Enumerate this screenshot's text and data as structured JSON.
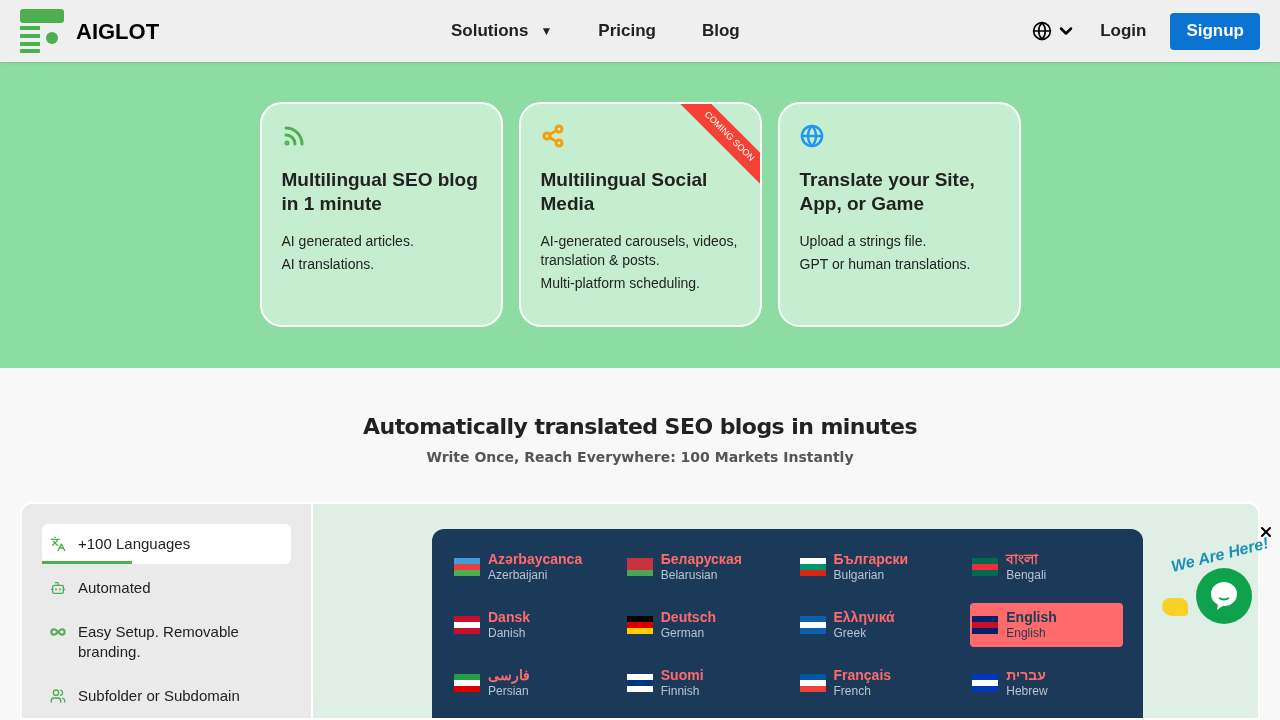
{
  "header": {
    "logo": "AIGLOT",
    "nav": [
      {
        "label": "Solutions",
        "caret": "▼"
      },
      {
        "label": "Pricing"
      },
      {
        "label": "Blog"
      }
    ],
    "login": "Login",
    "signup": "Signup"
  },
  "cards": [
    {
      "title": "Multilingual SEO blog in 1 minute",
      "lines": [
        "AI generated articles.",
        "AI translations."
      ]
    },
    {
      "title": "Multilingual Social Media",
      "lines": [
        "AI-generated carousels, videos, translation & posts.",
        "Multi-platform scheduling."
      ],
      "ribbon": "COMING SOON"
    },
    {
      "title": "Translate your Site, App, or Game",
      "lines": [
        "Upload a strings file.",
        "GPT or human translations."
      ]
    }
  ],
  "section": {
    "title": "Automatically translated SEO blogs in minutes",
    "subtitle": "Write Once, Reach Everywhere: 100 Markets Instantly"
  },
  "features": [
    {
      "label": "+100 Languages",
      "selected": true
    },
    {
      "label": "Automated",
      "selected": false
    },
    {
      "label": "Easy Setup. Removable branding.",
      "selected": false
    },
    {
      "label": "Subfolder or Subdomain",
      "selected": false
    }
  ],
  "languages": [
    {
      "native": "Azərbaycanca",
      "english": "Azerbaijani",
      "selected": false
    },
    {
      "native": "Беларуская",
      "english": "Belarusian",
      "selected": false
    },
    {
      "native": "Български",
      "english": "Bulgarian",
      "selected": false
    },
    {
      "native": "বাংলা",
      "english": "Bengali",
      "selected": false
    },
    {
      "native": "Dansk",
      "english": "Danish",
      "selected": false
    },
    {
      "native": "Deutsch",
      "english": "German",
      "selected": false
    },
    {
      "native": "Ελληνικά",
      "english": "Greek",
      "selected": false
    },
    {
      "native": "English",
      "english": "English",
      "selected": true
    },
    {
      "native": "فارسی",
      "english": "Persian",
      "selected": false
    },
    {
      "native": "Suomi",
      "english": "Finnish",
      "selected": false
    },
    {
      "native": "Français",
      "english": "French",
      "selected": false
    },
    {
      "native": "עברית",
      "english": "Hebrew",
      "selected": false
    }
  ],
  "chat": {
    "tagline": "We Are Here!"
  }
}
